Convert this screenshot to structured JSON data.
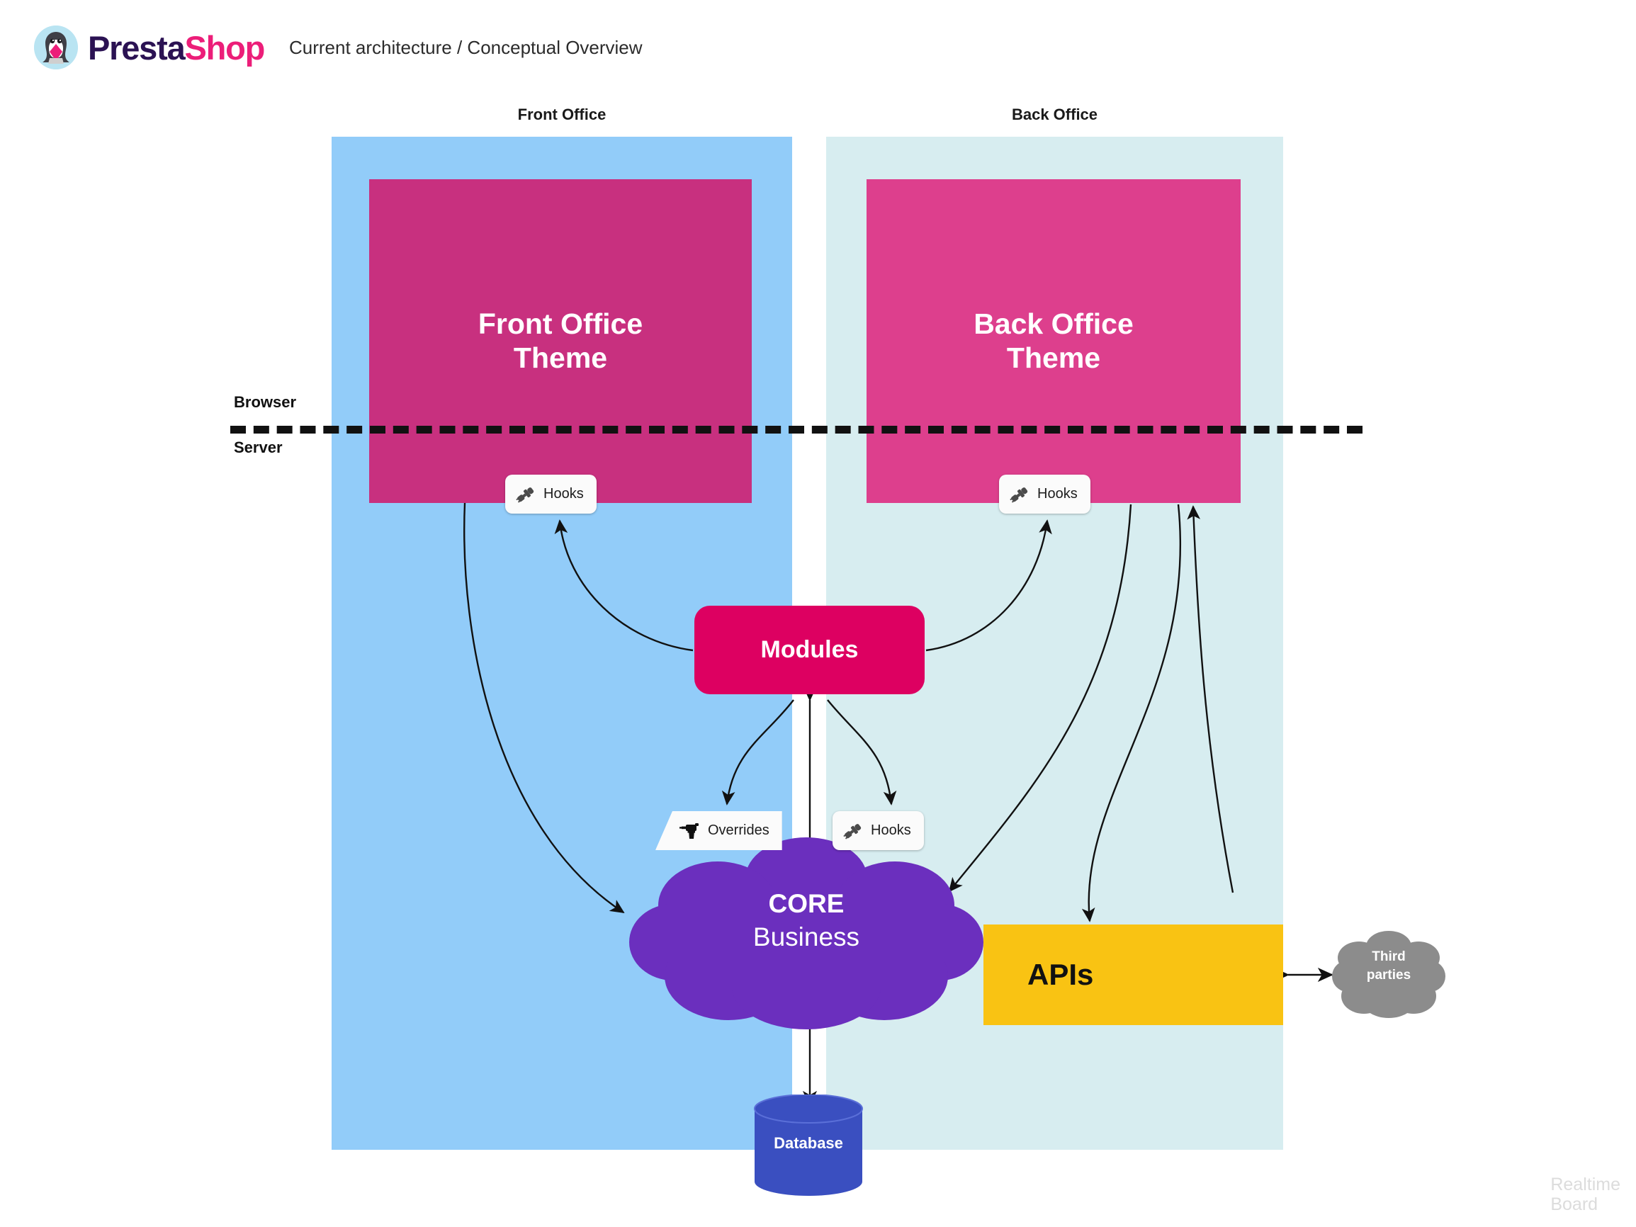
{
  "header": {
    "logo_icon": "prestashop-penguin-logo",
    "brand_part1": "Presta",
    "brand_part2": "Shop",
    "subtitle": "Current architecture / Conceptual Overview"
  },
  "zones": {
    "front_office_caption": "Front Office",
    "back_office_caption": "Back Office"
  },
  "boundary": {
    "browser_label": "Browser",
    "server_label": "Server"
  },
  "nodes": {
    "front_office_theme": {
      "line1": "Front Office",
      "line2": "Theme"
    },
    "back_office_theme": {
      "line1": "Back Office",
      "line2": "Theme"
    },
    "modules": {
      "label": "Modules"
    },
    "core": {
      "line1": "CORE",
      "line2": "Business"
    },
    "apis": {
      "label": "APIs"
    },
    "third_parties": {
      "line1": "Third",
      "line2": "parties"
    },
    "database": {
      "label": "Database"
    }
  },
  "badges": {
    "hooks_front_office": {
      "label": "Hooks",
      "icon": "plug-connector-icon"
    },
    "hooks_back_office": {
      "label": "Hooks",
      "icon": "plug-connector-icon"
    },
    "hooks_core": {
      "label": "Hooks",
      "icon": "plug-connector-icon"
    },
    "overrides": {
      "label": "Overrides",
      "icon": "drill-icon"
    }
  },
  "watermark": {
    "line1": "Realtime",
    "line2": "Board"
  },
  "colors": {
    "front_office_panel": "#92ccf9",
    "back_office_panel": "#d7edf0",
    "front_office_theme": "#c8307f",
    "back_office_theme": "#dd3f8d",
    "modules": "#dd0061",
    "core": "#6b2fbe",
    "apis": "#f9c313",
    "third_parties": "#8c8c8c",
    "database": "#3a4fc0",
    "brand_dark": "#2b1253",
    "brand_pink": "#ec1e79"
  }
}
